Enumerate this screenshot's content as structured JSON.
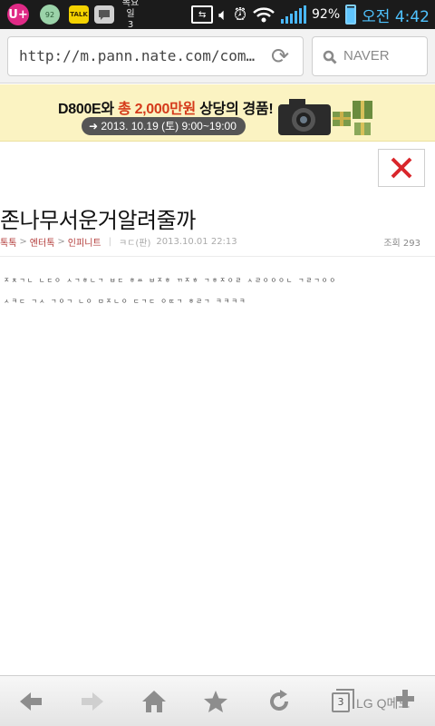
{
  "status_bar": {
    "carrier_badge": "U+",
    "talk_badge": "92",
    "kakao_badge": "TALK",
    "date_line1": "목요일",
    "date_line2": "3",
    "battery_percent": "92%",
    "time": "오전 4:42"
  },
  "address_bar": {
    "url": "http://m.pann.nate.com/common/i...",
    "search_placeholder": "NAVER"
  },
  "banner": {
    "model": "D800E와 ",
    "prize": "총 2,000만원",
    "tail": " 상당의 경품!",
    "date": "2013. 10.19 (토) 9:00~19:00"
  },
  "article": {
    "title": "존나무서운거알려줄까",
    "breadcrumb": [
      "톡톡",
      "엔터톡",
      "인피니트"
    ],
    "author": "ㅋㄷ(판)",
    "date": "2013.10.01 22:13",
    "views_label": "조회 293",
    "body_lines": [
      "ㅈㅊㄱㄴ ㄴㄷㅇ ㅅㄱㅎㄴㄱ ㅂㄷ ㅎㅆ ㅂㅈㅎ ㄲㅈㅎ ㄱㅎㅈㅇㄹ ㅅㄹㅇㅇㅇㄴ ㄱㄹㄱㅇㅇ",
      "ㅅㅋㄷ ㄱㅅ ㄱㅇㄱ ㄴㅇ ㅁㅈㄴㅇ ㄷㄱㄷ ㅇㄸㄱ ㅎㄹㄱ ㅋㅋㅋㅋ"
    ]
  },
  "toolbar": {
    "tab_count": "3",
    "memo_label": "LG Q메모"
  },
  "colors": {
    "banner_bg": "#fbf3c2",
    "banner_highlight": "#d53a1a",
    "close_x": "#d9262b",
    "breadcrumb": "#b23a38",
    "clock": "#4fc3ff"
  }
}
